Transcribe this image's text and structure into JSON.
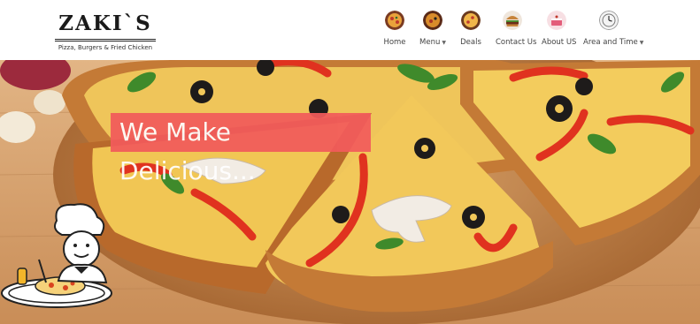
{
  "brand": {
    "name": "ZAKI`S",
    "subtitle": "Pizza, Burgers & Fried Chicken"
  },
  "nav": {
    "items": [
      {
        "label": "Home",
        "icon": "pizza-icon",
        "has_dropdown": false
      },
      {
        "label": "Menu",
        "icon": "pizza-icon",
        "has_dropdown": true
      },
      {
        "label": "Deals",
        "icon": "pizza-icon",
        "has_dropdown": false
      },
      {
        "label": "Contact Us",
        "icon": "burger-icon",
        "has_dropdown": false
      },
      {
        "label": "About US",
        "icon": "cake-icon",
        "has_dropdown": false
      },
      {
        "label": "Area and Time",
        "icon": "clock-icon",
        "has_dropdown": true
      }
    ],
    "caret": "▼"
  },
  "hero": {
    "tagline": "We Make Delicious..."
  },
  "colors": {
    "tagline_bg": "#f25b5b",
    "wood": "#d7a573",
    "crust": "#c97a3a",
    "cheese": "#f2c94c",
    "pepper": "#e0321f"
  }
}
